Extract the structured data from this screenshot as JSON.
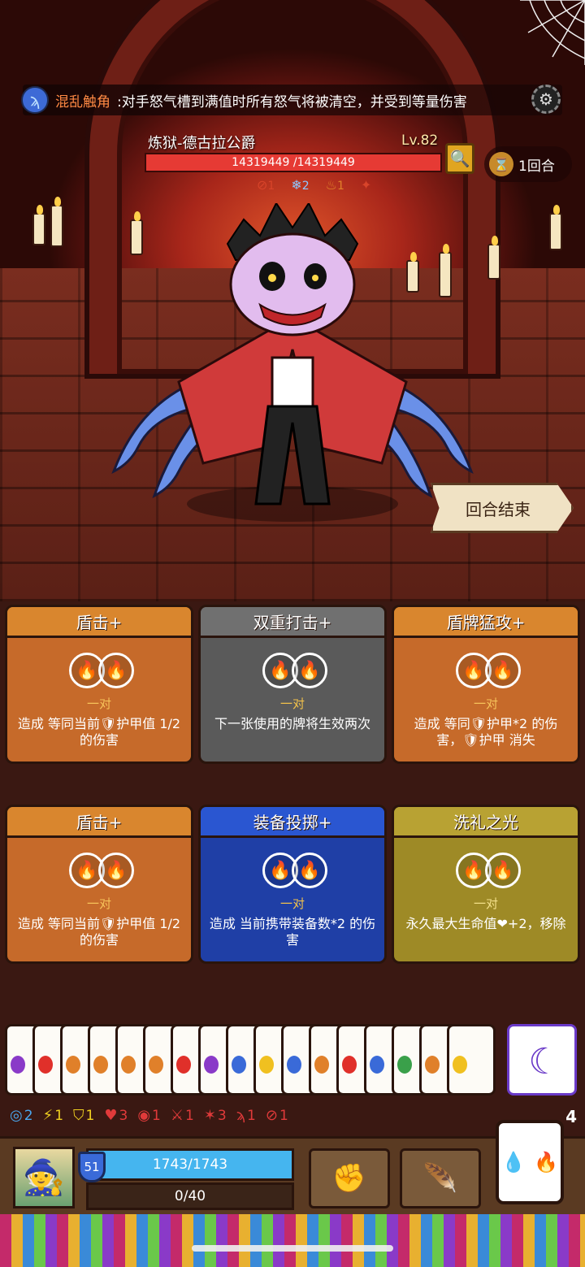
{
  "ability": {
    "name": "混乱触角",
    "separator": ":",
    "desc": "对手怒气槽到满值时所有怒气将被清空，并受到等量伤害"
  },
  "boss": {
    "name": "炼狱-德古拉公爵",
    "level": "Lv.82",
    "hp": "14319449 /14319449"
  },
  "round": {
    "label": "1回合"
  },
  "boss_status": [
    {
      "icon": "broken-shield-icon",
      "glyph": "⊘",
      "value": "1",
      "color": "#d8442a"
    },
    {
      "icon": "snowflake-icon",
      "glyph": "❄",
      "value": "2",
      "color": "#8ec8ff"
    },
    {
      "icon": "flame-icon",
      "glyph": "♨",
      "value": "1",
      "color": "#e0802a"
    },
    {
      "icon": "curse-icon",
      "glyph": "✦",
      "value": "",
      "color": "#d8442a"
    }
  ],
  "end_turn": "回合结束",
  "cards": [
    {
      "title": "盾击+",
      "style": "orange",
      "pair": "一对",
      "desc": "造成 等同当前🛡护甲值 1/2 的伤害"
    },
    {
      "title": "双重打击+",
      "style": "grey",
      "pair": "一对",
      "desc": "下一张使用的牌将生效两次"
    },
    {
      "title": "盾牌猛攻+",
      "style": "orange",
      "pair": "一对",
      "desc": "造成 等同🛡护甲*2 的伤害，🛡护甲 消失"
    },
    {
      "title": "盾击+",
      "style": "orange",
      "pair": "一对",
      "desc": "造成 等同当前🛡护甲值 1/2 的伤害"
    },
    {
      "title": "装备投掷+",
      "style": "blue",
      "pair": "一对",
      "desc": "造成 当前携带装备数*2 的伤害"
    },
    {
      "title": "洗礼之光",
      "style": "olive",
      "pair": "一对",
      "desc": "永久最大生命值❤+2，移除"
    }
  ],
  "hand_colors": [
    "#8a3ac8",
    "#e0302a",
    "#e0802a",
    "#e0802a",
    "#e0802a",
    "#e0802a",
    "#e0302a",
    "#8a3ac8",
    "#3a6ad8",
    "#f0c020",
    "#3a6ad8",
    "#e0802a",
    "#e0302a",
    "#3a6ad8",
    "#3aa04a",
    "#e0802a",
    "#f0c020"
  ],
  "stats": [
    {
      "icon": "swirl-icon",
      "glyph": "◎",
      "value": "2",
      "color": "#4aa8f0"
    },
    {
      "icon": "lightning-icon",
      "glyph": "⚡",
      "value": "1",
      "color": "#f0d020"
    },
    {
      "icon": "shield-icon",
      "glyph": "⛉",
      "value": "1",
      "color": "#f0d020"
    },
    {
      "icon": "heart-shield-icon",
      "glyph": "♥",
      "value": "3",
      "color": "#e03a3a"
    },
    {
      "icon": "target-icon",
      "glyph": "◉",
      "value": "1",
      "color": "#e03a3a"
    },
    {
      "icon": "sword-shield-icon",
      "glyph": "⚔",
      "value": "1",
      "color": "#e03a3a"
    },
    {
      "icon": "claw-icon",
      "glyph": "✶",
      "value": "3",
      "color": "#e03a3a"
    },
    {
      "icon": "bleed-icon",
      "glyph": "ϡ",
      "value": "1",
      "color": "#e03a3a"
    },
    {
      "icon": "strike-icon",
      "glyph": "⊘",
      "value": "1",
      "color": "#e03a3a"
    }
  ],
  "deck_count": "4",
  "player": {
    "level": "51",
    "hp": "1743/1743",
    "rage": "0/40"
  }
}
